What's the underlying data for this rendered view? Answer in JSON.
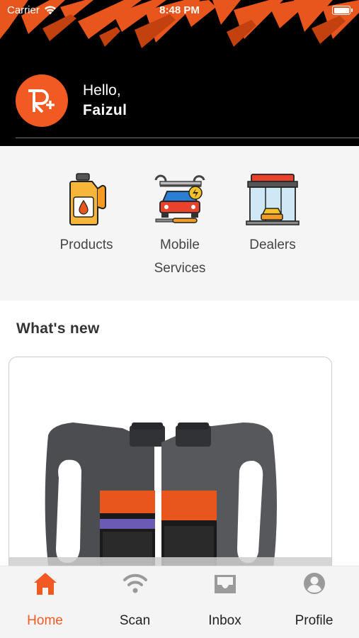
{
  "status_bar": {
    "carrier": "Carrier",
    "time": "8:48 PM"
  },
  "header": {
    "logo_text": "R+",
    "greeting": "Hello,",
    "user_name": "Faizul"
  },
  "services": [
    {
      "label": "Products",
      "icon": "oil-bottle-icon"
    },
    {
      "label": "Mobile",
      "label2": "Services",
      "icon": "car-tools-icon"
    },
    {
      "label": "Dealers",
      "icon": "dealer-shop-icon"
    }
  ],
  "whats_new": {
    "title": "What's new"
  },
  "tabs": [
    {
      "label": "Home",
      "icon": "home-icon",
      "active": true
    },
    {
      "label": "Scan",
      "icon": "wifi-scan-icon",
      "active": false
    },
    {
      "label": "Inbox",
      "icon": "inbox-icon",
      "active": false
    },
    {
      "label": "Profile",
      "icon": "profile-icon",
      "active": false
    }
  ],
  "colors": {
    "accent": "#f15a22",
    "header_bg": "#000000",
    "section_bg": "#f5f5f5"
  }
}
